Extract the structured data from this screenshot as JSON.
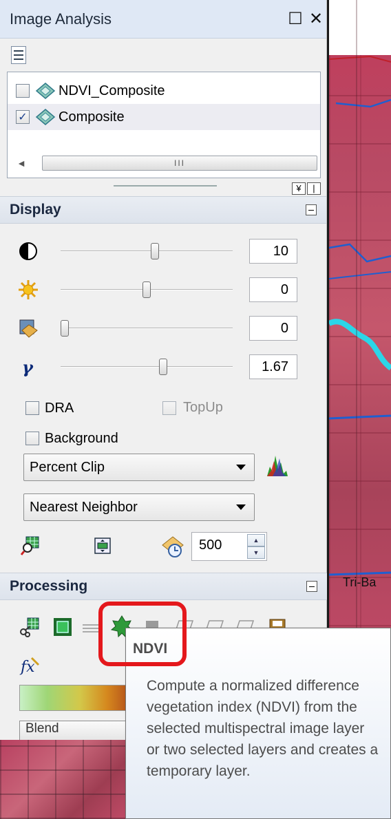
{
  "window": {
    "title": "Image Analysis"
  },
  "layers": [
    {
      "name": "NDVI_Composite",
      "checked": false
    },
    {
      "name": "Composite",
      "checked": true
    }
  ],
  "scrollbar": {
    "thumb_grip": "III"
  },
  "display": {
    "header": "Display",
    "sliders": [
      {
        "icon": "contrast-icon",
        "value": "10",
        "level": 0.55
      },
      {
        "icon": "brightness-icon",
        "value": "0",
        "level": 0.5
      },
      {
        "icon": "transparency-icon",
        "value": "0",
        "level": 0.0
      },
      {
        "icon": "gamma-icon",
        "value": "1.67",
        "level": 0.6
      }
    ],
    "dra_label": "DRA",
    "topup_label": "TopUp",
    "background_label": "Background",
    "stretch_select": "Percent Clip",
    "resample_select": "Nearest Neighbor",
    "refresh_interval": "500"
  },
  "processing": {
    "header": "Processing",
    "blend_select": "Blend"
  },
  "map": {
    "label": "Tri-Ba"
  },
  "tooltip": {
    "title": "NDVI",
    "body": "Compute a normalized difference vegetation index (NDVI) from the selected multispectral image layer or two selected layers and creates a temporary layer."
  },
  "colors": {
    "highlight": "#e4181c",
    "map_red": "#c23a5a",
    "river": "#2bd6e8"
  }
}
